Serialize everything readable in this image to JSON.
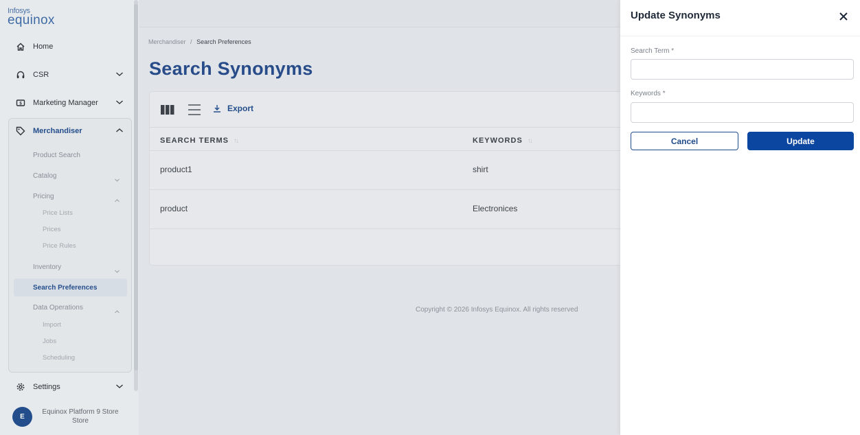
{
  "brand": {
    "line1": "Infosys",
    "line2": "equinox"
  },
  "sidebar": {
    "items": [
      {
        "label": "Home"
      },
      {
        "label": "CSR"
      },
      {
        "label": "Marketing Manager"
      },
      {
        "label": "Merchandiser"
      }
    ],
    "merchandiser_subs": {
      "product_search": "Product Search",
      "catalog": "Catalog",
      "pricing": "Pricing",
      "price_lists": "Price Lists",
      "prices": "Prices",
      "price_rules": "Price Rules",
      "inventory": "Inventory",
      "search_preferences": "Search Preferences",
      "data_operations": "Data Operations",
      "import": "Import",
      "jobs": "Jobs",
      "scheduling": "Scheduling"
    },
    "settings": "Settings",
    "user": {
      "initial": "E",
      "name_line1": "Equinox Platform 9 Store",
      "name_line2": "Store"
    }
  },
  "breadcrumb": {
    "parent": "Merchandiser",
    "separator": "/",
    "current": "Search Preferences"
  },
  "page": {
    "title": "Search Synonyms"
  },
  "toolbar": {
    "export_label": "Export"
  },
  "table": {
    "columns": [
      "SEARCH TERMS",
      "KEYWORDS"
    ],
    "rows": [
      {
        "search_term": "product1",
        "keywords": "shirt"
      },
      {
        "search_term": "product",
        "keywords": "Electronices"
      }
    ]
  },
  "footer": {
    "copyright": "Copyright © 2026 Infosys Equinox. All rights reserved"
  },
  "drawer": {
    "title": "Update Synonyms",
    "fields": {
      "search_term_label": "Search Term",
      "search_term_value": "",
      "keywords_label": "Keywords",
      "keywords_value": "",
      "required_mark": "*"
    },
    "cancel_label": "Cancel",
    "update_label": "Update"
  },
  "colors": {
    "brand_blue": "#1f4a8c",
    "primary_button": "#0b46a0",
    "title_blue": "#24498a"
  }
}
